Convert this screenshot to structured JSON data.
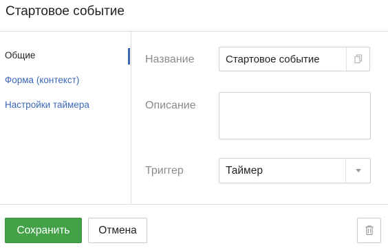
{
  "dialog": {
    "title": "Стартовое событие"
  },
  "sidebar": {
    "items": [
      {
        "label": "Общие",
        "active": true
      },
      {
        "label": "Форма (контекст)",
        "active": false
      },
      {
        "label": "Настройки таймера",
        "active": false
      }
    ]
  },
  "form": {
    "name_label": "Название",
    "name_value": "Стартовое событие",
    "description_label": "Описание",
    "description_value": "",
    "trigger_label": "Триггер",
    "trigger_value": "Таймер"
  },
  "footer": {
    "save_label": "Сохранить",
    "cancel_label": "Отмена"
  },
  "icons": {
    "copy": "copy-icon",
    "dropdown": "chevron-down-icon",
    "delete": "trash-icon"
  },
  "colors": {
    "accent": "#3b66b8",
    "save_button": "#43a148"
  }
}
